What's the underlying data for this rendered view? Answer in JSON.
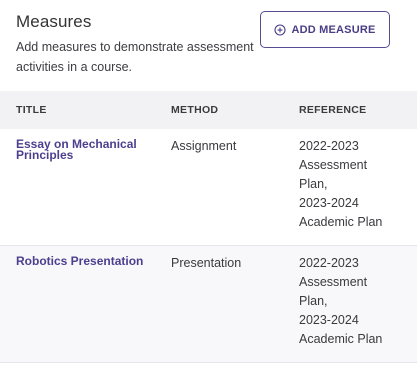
{
  "header": {
    "title": "Measures",
    "subtitle": "Add measures to demonstrate assessment activities in a course.",
    "add_button_label": "ADD MEASURE",
    "add_button_icon": "plus-circle-icon"
  },
  "table": {
    "columns": [
      "TITLE",
      "METHOD",
      "REFERENCE"
    ],
    "rows": [
      {
        "title": "Essay on Mechanical Principles",
        "method": "Assignment",
        "reference": [
          "2022-2023",
          "Assessment",
          "Plan,",
          "2023-2024",
          "Academic Plan"
        ]
      },
      {
        "title": "Robotics Presentation",
        "method": "Presentation",
        "reference": [
          "2022-2023",
          "Assessment",
          "Plan,",
          "2023-2024",
          "Academic Plan"
        ]
      }
    ]
  },
  "colors": {
    "accent": "#4d3f8f",
    "header_row_bg": "#f2f2f4",
    "alt_row_bg": "#f8f8fa"
  }
}
